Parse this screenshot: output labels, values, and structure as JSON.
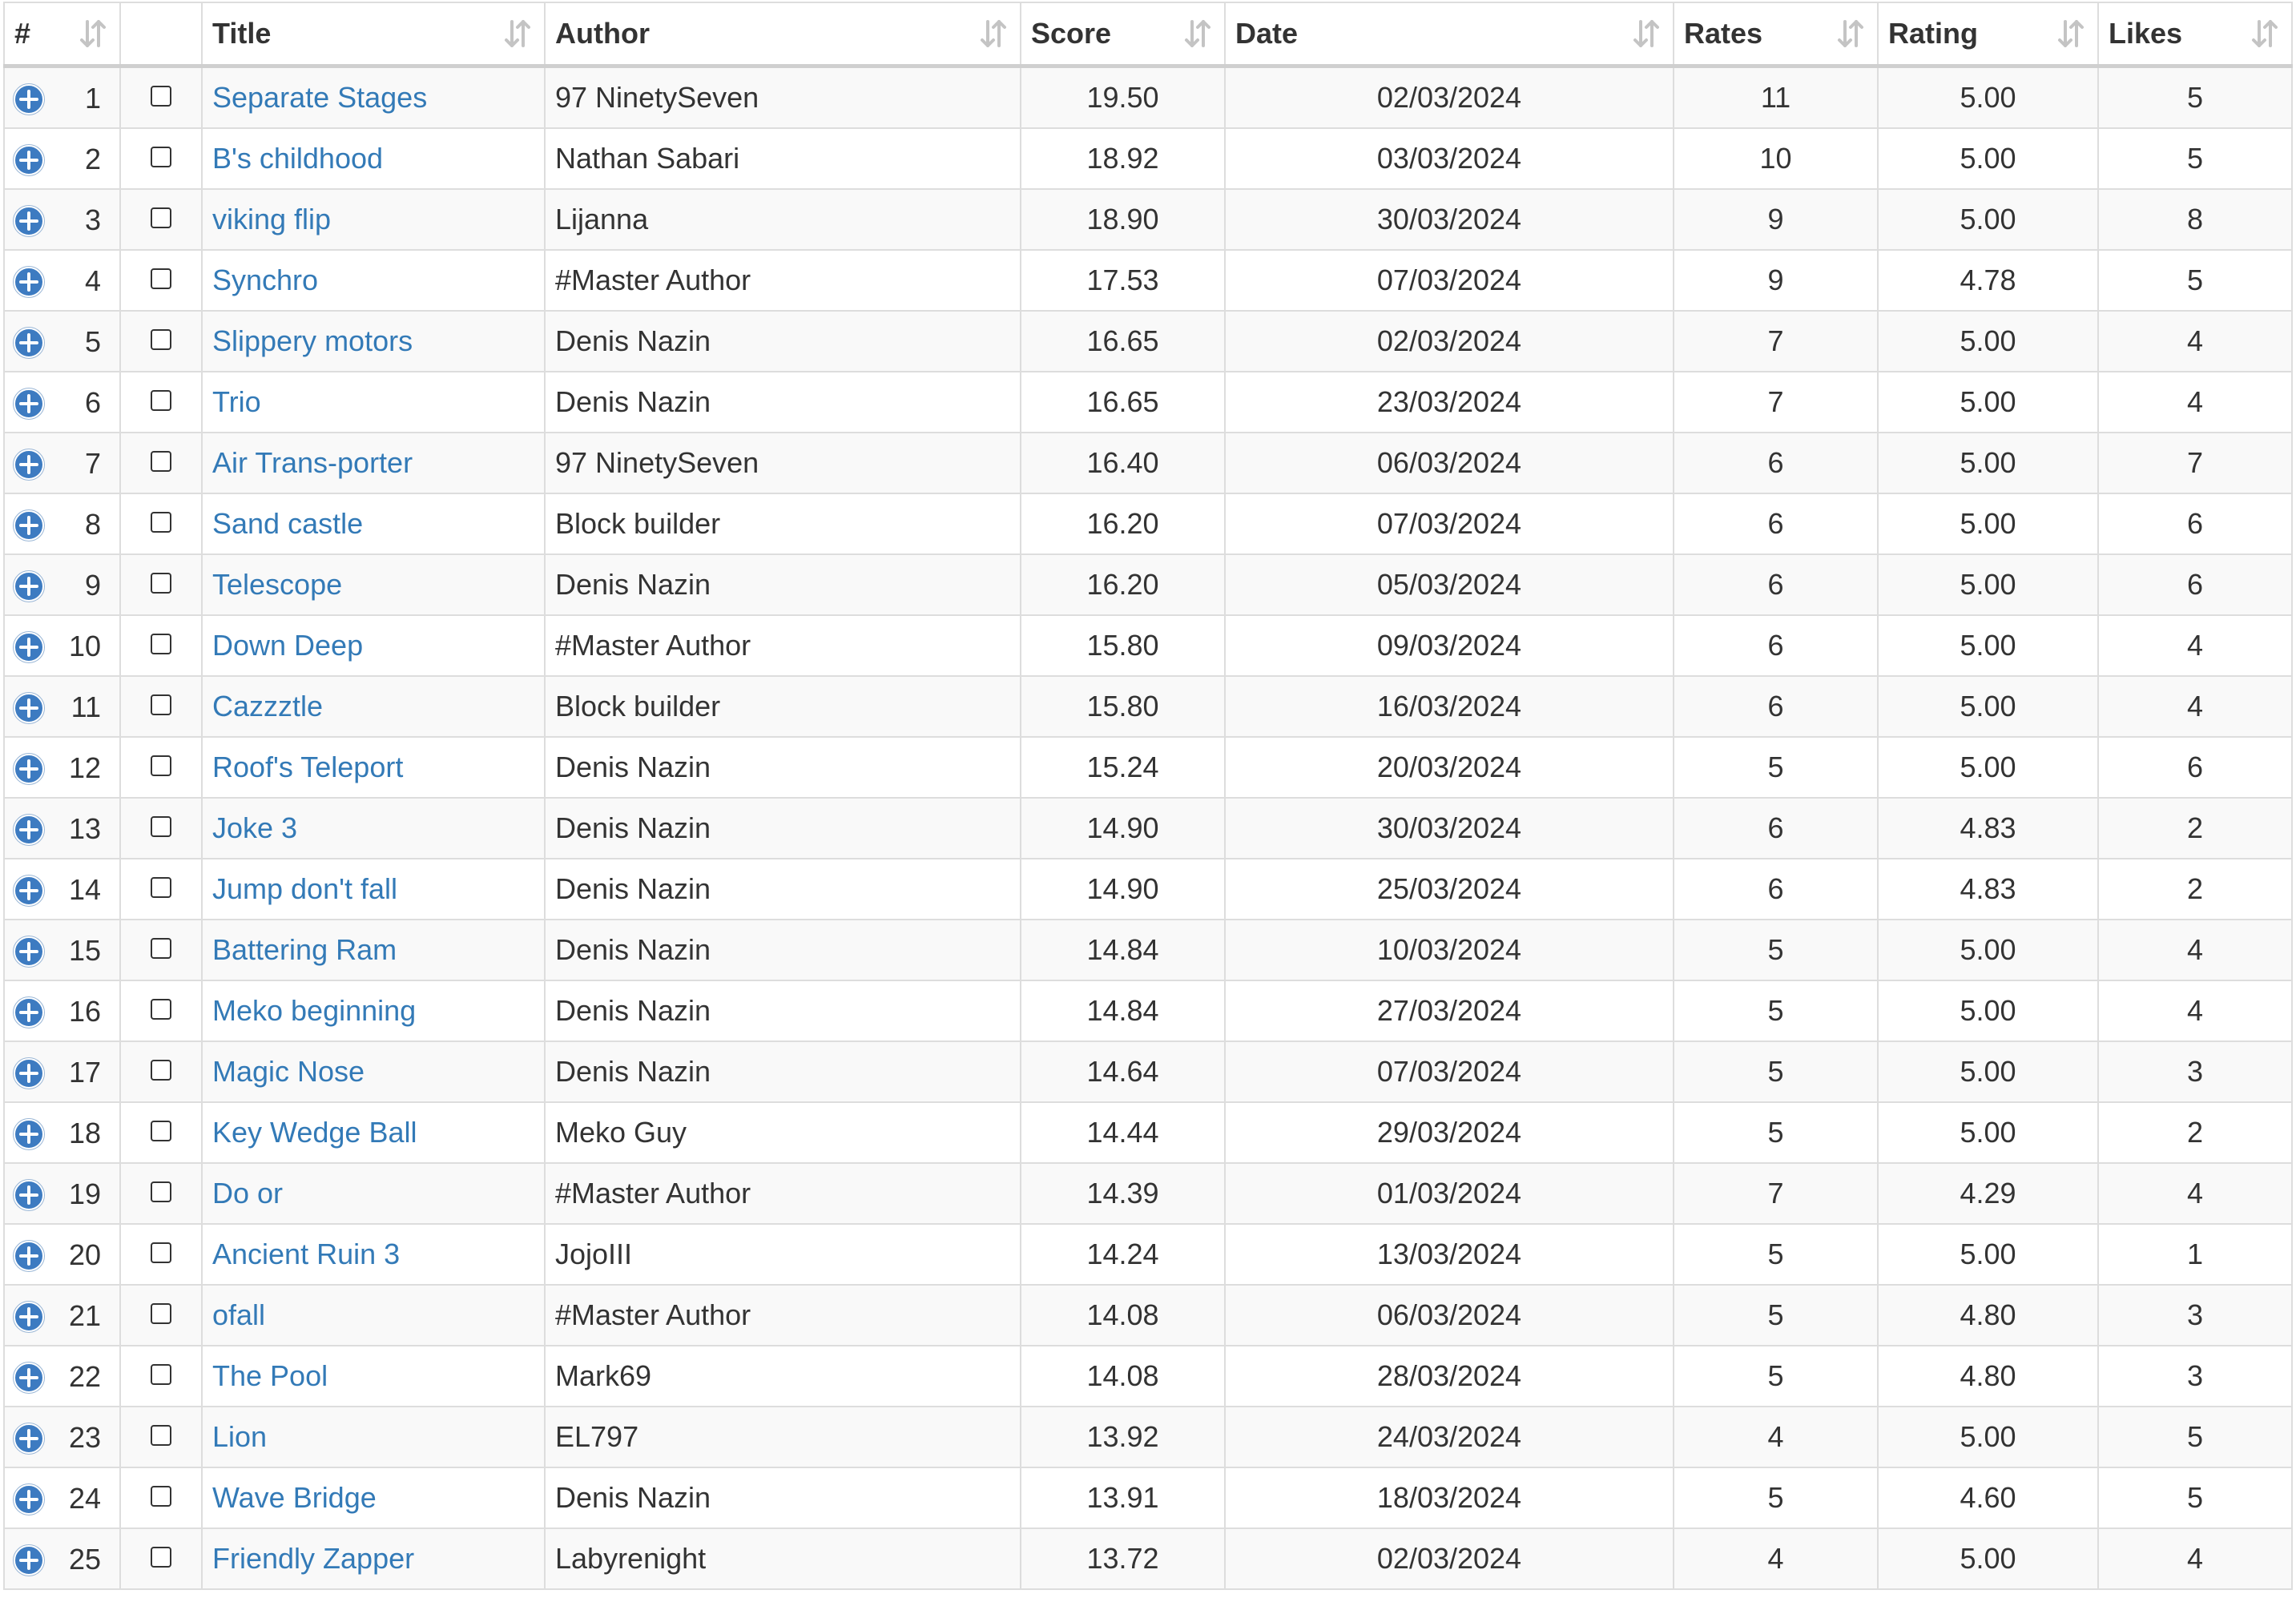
{
  "table": {
    "columns": [
      {
        "key": "num",
        "label": "#"
      },
      {
        "key": "check",
        "label": ""
      },
      {
        "key": "title",
        "label": "Title"
      },
      {
        "key": "author",
        "label": "Author"
      },
      {
        "key": "score",
        "label": "Score"
      },
      {
        "key": "date",
        "label": "Date"
      },
      {
        "key": "rates",
        "label": "Rates"
      },
      {
        "key": "rating",
        "label": "Rating"
      },
      {
        "key": "likes",
        "label": "Likes"
      }
    ],
    "rows": [
      {
        "num": "1",
        "title": "Separate Stages",
        "author": "97 NinetySeven",
        "score": "19.50",
        "date": "02/03/2024",
        "rates": "11",
        "rating": "5.00",
        "likes": "5"
      },
      {
        "num": "2",
        "title": "B's childhood",
        "author": "Nathan Sabari",
        "score": "18.92",
        "date": "03/03/2024",
        "rates": "10",
        "rating": "5.00",
        "likes": "5"
      },
      {
        "num": "3",
        "title": "viking flip",
        "author": "Lijanna",
        "score": "18.90",
        "date": "30/03/2024",
        "rates": "9",
        "rating": "5.00",
        "likes": "8"
      },
      {
        "num": "4",
        "title": "Synchro",
        "author": "#Master Author",
        "score": "17.53",
        "date": "07/03/2024",
        "rates": "9",
        "rating": "4.78",
        "likes": "5"
      },
      {
        "num": "5",
        "title": "Slippery motors",
        "author": "Denis Nazin",
        "score": "16.65",
        "date": "02/03/2024",
        "rates": "7",
        "rating": "5.00",
        "likes": "4"
      },
      {
        "num": "6",
        "title": "Trio",
        "author": "Denis Nazin",
        "score": "16.65",
        "date": "23/03/2024",
        "rates": "7",
        "rating": "5.00",
        "likes": "4"
      },
      {
        "num": "7",
        "title": "Air Trans-porter",
        "author": "97 NinetySeven",
        "score": "16.40",
        "date": "06/03/2024",
        "rates": "6",
        "rating": "5.00",
        "likes": "7"
      },
      {
        "num": "8",
        "title": "Sand castle",
        "author": "Block builder",
        "score": "16.20",
        "date": "07/03/2024",
        "rates": "6",
        "rating": "5.00",
        "likes": "6"
      },
      {
        "num": "9",
        "title": "Telescope",
        "author": "Denis Nazin",
        "score": "16.20",
        "date": "05/03/2024",
        "rates": "6",
        "rating": "5.00",
        "likes": "6"
      },
      {
        "num": "10",
        "title": "Down Deep",
        "author": "#Master Author",
        "score": "15.80",
        "date": "09/03/2024",
        "rates": "6",
        "rating": "5.00",
        "likes": "4"
      },
      {
        "num": "11",
        "title": "Cazzztle",
        "author": "Block builder",
        "score": "15.80",
        "date": "16/03/2024",
        "rates": "6",
        "rating": "5.00",
        "likes": "4"
      },
      {
        "num": "12",
        "title": "Roof's Teleport",
        "author": "Denis Nazin",
        "score": "15.24",
        "date": "20/03/2024",
        "rates": "5",
        "rating": "5.00",
        "likes": "6"
      },
      {
        "num": "13",
        "title": "Joke 3",
        "author": "Denis Nazin",
        "score": "14.90",
        "date": "30/03/2024",
        "rates": "6",
        "rating": "4.83",
        "likes": "2"
      },
      {
        "num": "14",
        "title": "Jump don't fall",
        "author": "Denis Nazin",
        "score": "14.90",
        "date": "25/03/2024",
        "rates": "6",
        "rating": "4.83",
        "likes": "2"
      },
      {
        "num": "15",
        "title": "Battering Ram",
        "author": "Denis Nazin",
        "score": "14.84",
        "date": "10/03/2024",
        "rates": "5",
        "rating": "5.00",
        "likes": "4"
      },
      {
        "num": "16",
        "title": "Meko beginning",
        "author": "Denis Nazin",
        "score": "14.84",
        "date": "27/03/2024",
        "rates": "5",
        "rating": "5.00",
        "likes": "4"
      },
      {
        "num": "17",
        "title": "Magic Nose",
        "author": "Denis Nazin",
        "score": "14.64",
        "date": "07/03/2024",
        "rates": "5",
        "rating": "5.00",
        "likes": "3"
      },
      {
        "num": "18",
        "title": "Key Wedge Ball",
        "author": "Meko Guy",
        "score": "14.44",
        "date": "29/03/2024",
        "rates": "5",
        "rating": "5.00",
        "likes": "2"
      },
      {
        "num": "19",
        "title": "Do or",
        "author": "#Master Author",
        "score": "14.39",
        "date": "01/03/2024",
        "rates": "7",
        "rating": "4.29",
        "likes": "4"
      },
      {
        "num": "20",
        "title": "Ancient Ruin 3",
        "author": "JojoIII",
        "score": "14.24",
        "date": "13/03/2024",
        "rates": "5",
        "rating": "5.00",
        "likes": "1"
      },
      {
        "num": "21",
        "title": "ofall",
        "author": "#Master Author",
        "score": "14.08",
        "date": "06/03/2024",
        "rates": "5",
        "rating": "4.80",
        "likes": "3"
      },
      {
        "num": "22",
        "title": "The Pool",
        "author": "Mark69",
        "score": "14.08",
        "date": "28/03/2024",
        "rates": "5",
        "rating": "4.80",
        "likes": "3"
      },
      {
        "num": "23",
        "title": "Lion",
        "author": "EL797",
        "score": "13.92",
        "date": "24/03/2024",
        "rates": "4",
        "rating": "5.00",
        "likes": "5"
      },
      {
        "num": "24",
        "title": "Wave Bridge",
        "author": "Denis Nazin",
        "score": "13.91",
        "date": "18/03/2024",
        "rates": "5",
        "rating": "4.60",
        "likes": "5"
      },
      {
        "num": "25",
        "title": "Friendly Zapper",
        "author": "Labyrenight",
        "score": "13.72",
        "date": "02/03/2024",
        "rates": "4",
        "rating": "5.00",
        "likes": "4"
      }
    ]
  },
  "icons": {
    "expand": "plus-circle-icon",
    "sort": "sort-arrows-icon",
    "checkbox": "checkbox-unchecked"
  },
  "colors": {
    "link": "#337ab7",
    "expand_icon": "#3d7bc1",
    "border": "#dddddd",
    "row_stripe": "#f9f9f9",
    "text": "#333333",
    "sort_icon": "#c4c4c4"
  }
}
